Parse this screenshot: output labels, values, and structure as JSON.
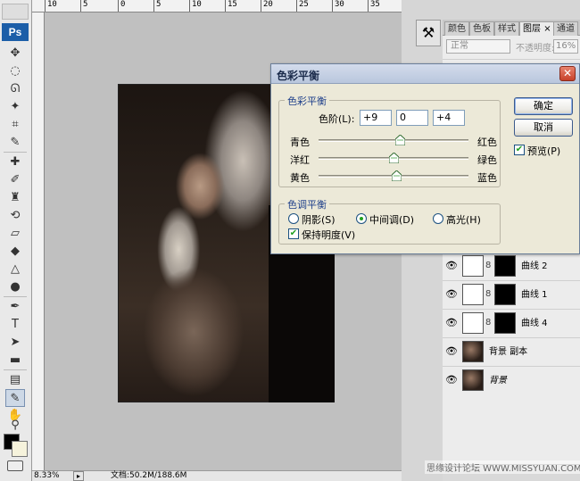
{
  "app": {
    "logo": "Ps"
  },
  "ruler": {
    "top_ticks": [
      "10",
      "5",
      "0",
      "5",
      "10",
      "15",
      "20",
      "25",
      "30",
      "35"
    ]
  },
  "status": {
    "zoom": "8.33%",
    "doc_size": "文档:50.2M/188.6M"
  },
  "panels": {
    "tabs": [
      "颜色",
      "色板",
      "样式",
      "图层",
      "通道"
    ],
    "active_tab": "图层",
    "blend_mode": "正常",
    "opacity_label": "不透明度:",
    "opacity_value": "16%",
    "layers": [
      {
        "name": "曲线 2",
        "kind": "adjustment"
      },
      {
        "name": "曲线 1",
        "kind": "adjustment"
      },
      {
        "name": "曲线 4",
        "kind": "adjustment"
      },
      {
        "name": "背景 副本",
        "kind": "image"
      },
      {
        "name": "背景",
        "kind": "image"
      }
    ]
  },
  "watermark": "思缘设计论坛 WWW.MISSYUAN.COM",
  "dialog": {
    "title": "色彩平衡",
    "balance_group": "色彩平衡",
    "levels_label": "色阶(L):",
    "levels": [
      "+9",
      "0",
      "+4"
    ],
    "sliders": [
      {
        "left": "青色",
        "right": "红色",
        "value": 9
      },
      {
        "left": "洋红",
        "right": "绿色",
        "value": 0
      },
      {
        "left": "黄色",
        "right": "蓝色",
        "value": 4
      }
    ],
    "tone_group": "色调平衡",
    "tones": [
      {
        "label": "阴影(S)",
        "selected": false
      },
      {
        "label": "中间调(D)",
        "selected": true
      },
      {
        "label": "高光(H)",
        "selected": false
      }
    ],
    "preserve_luminosity": {
      "label": "保持明度(V)",
      "checked": true
    },
    "ok_label": "确定",
    "cancel_label": "取消",
    "preview": {
      "label": "预览(P)",
      "checked": true
    }
  }
}
